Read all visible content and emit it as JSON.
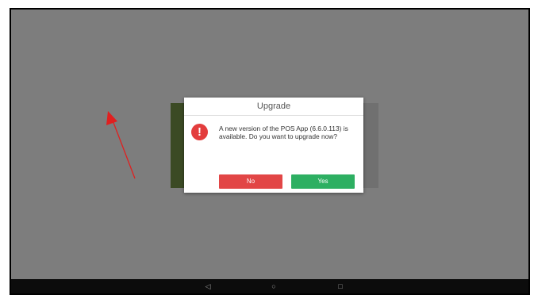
{
  "dialog": {
    "title": "Upgrade",
    "message": "A new version of the POS App (6.6.0.113) is available. Do you want to upgrade now?",
    "no_label": "No",
    "yes_label": "Yes",
    "icon": "alert-exclamation-icon"
  },
  "nav_bar": {
    "back_glyph": "◁",
    "home_glyph": "○",
    "recent_glyph": "□"
  },
  "colors": {
    "dim_overlay": "#7d7d7d",
    "no_button": "#e24646",
    "yes_button": "#2daf62",
    "alert_icon": "#e33d3d",
    "annotation_arrow": "#e02020"
  }
}
